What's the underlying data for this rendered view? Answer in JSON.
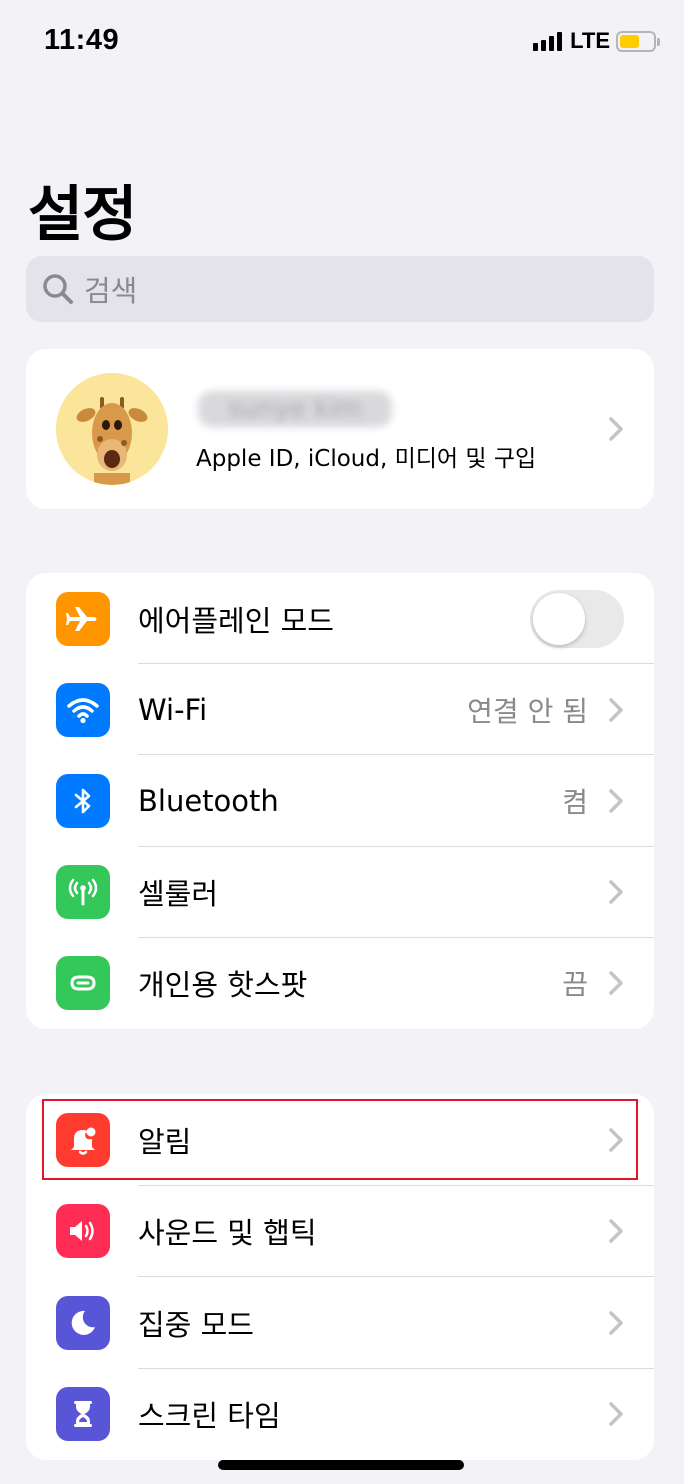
{
  "status_bar": {
    "time": "11:49",
    "network": "LTE",
    "battery_color": "#ffcc00"
  },
  "title": "설정",
  "search": {
    "placeholder": "검색"
  },
  "profile": {
    "name": "sunye kim",
    "subtitle": "Apple ID, iCloud, 미디어 및 구입"
  },
  "group1": [
    {
      "label": "에어플레인 모드",
      "icon": "airplane-icon",
      "color": "#ff9500",
      "toggle": false
    },
    {
      "label": "Wi-Fi",
      "value": "연결 안 됨",
      "icon": "wifi-icon",
      "color": "#007aff"
    },
    {
      "label": "Bluetooth",
      "value": "켬",
      "icon": "bluetooth-icon",
      "color": "#007aff"
    },
    {
      "label": "셀룰러",
      "value": "",
      "icon": "cellular-icon",
      "color": "#34c759"
    },
    {
      "label": "개인용 핫스팟",
      "value": "끔",
      "icon": "hotspot-icon",
      "color": "#34c759"
    }
  ],
  "group2": [
    {
      "label": "알림",
      "icon": "notification-bell-icon",
      "color": "#ff3b30"
    },
    {
      "label": "사운드 및 햅틱",
      "icon": "speaker-icon",
      "color": "#ff2d55"
    },
    {
      "label": "집중 모드",
      "icon": "moon-icon",
      "color": "#5856d6"
    },
    {
      "label": "스크린 타임",
      "icon": "hourglass-icon",
      "color": "#5856d6"
    }
  ],
  "highlight_color": "#e0162b"
}
